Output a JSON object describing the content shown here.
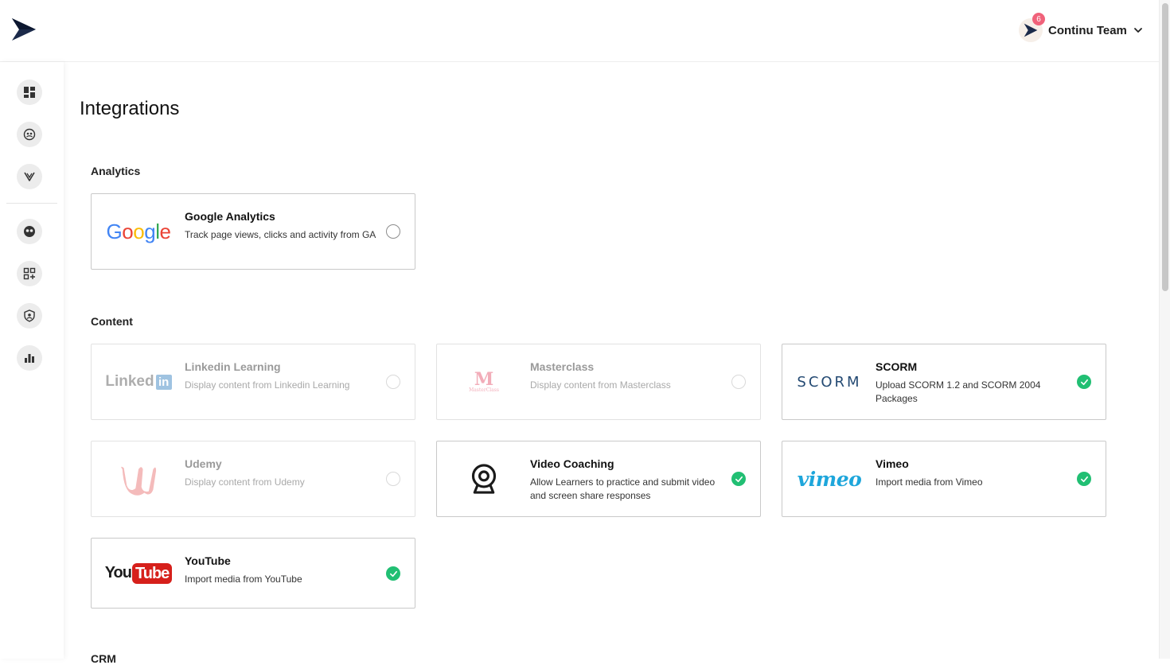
{
  "header": {
    "account_name": "Continu Team",
    "notification_count": "6"
  },
  "page": {
    "title": "Integrations"
  },
  "sections": {
    "analytics": "Analytics",
    "content": "Content",
    "crm": "CRM"
  },
  "logos": {
    "google": "Google",
    "linkedin_word": "Linked",
    "linkedin_in": "in",
    "masterclass_mark": "M",
    "masterclass_small": "MasterClass",
    "scorm": "SCORM",
    "vimeo": "vimeo",
    "youtube_you": "You",
    "youtube_tube": "Tube"
  },
  "cards": {
    "google_analytics": {
      "title": "Google Analytics",
      "desc": "Track page views, clicks and activity from GA",
      "state": "unselected"
    },
    "linkedin": {
      "title": "Linkedin Learning",
      "desc": "Display content from Linkedin Learning",
      "state": "disabled"
    },
    "masterclass": {
      "title": "Masterclass",
      "desc": "Display content from Masterclass",
      "state": "disabled"
    },
    "scorm": {
      "title": "SCORM",
      "desc": "Upload SCORM 1.2 and SCORM 2004 Packages",
      "state": "enabled"
    },
    "udemy": {
      "title": "Udemy",
      "desc": "Display content from Udemy",
      "state": "disabled"
    },
    "video_coaching": {
      "title": "Video Coaching",
      "desc": "Allow Learners to practice and submit video and screen share responses",
      "state": "enabled"
    },
    "vimeo": {
      "title": "Vimeo",
      "desc": "Import media from Vimeo",
      "state": "enabled"
    },
    "youtube": {
      "title": "YouTube",
      "desc": "Import media from YouTube",
      "state": "enabled"
    }
  },
  "colors": {
    "check_green": "#21bf73",
    "badge_pink": "#f0627a",
    "brand_navy": "#1b2a4a"
  },
  "icons": {
    "sidebar": [
      "dashboard-icon",
      "users-icon",
      "learning-icon",
      "community-icon",
      "apps-icon",
      "shield-icon",
      "analytics-icon"
    ]
  }
}
